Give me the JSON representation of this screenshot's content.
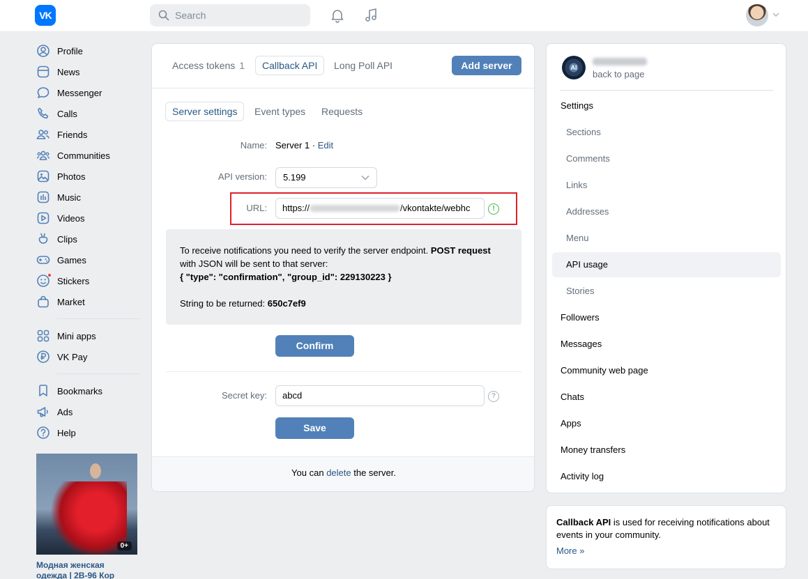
{
  "header": {
    "logo_text": "VK",
    "search_placeholder": "Search"
  },
  "nav": {
    "items": [
      {
        "label": "Profile",
        "icon": "user-circle-icon"
      },
      {
        "label": "News",
        "icon": "news-icon"
      },
      {
        "label": "Messenger",
        "icon": "chat-bubble-icon"
      },
      {
        "label": "Calls",
        "icon": "phone-icon"
      },
      {
        "label": "Friends",
        "icon": "friends-icon"
      },
      {
        "label": "Communities",
        "icon": "communities-icon"
      },
      {
        "label": "Photos",
        "icon": "photo-icon"
      },
      {
        "label": "Music",
        "icon": "music-bars-icon"
      },
      {
        "label": "Videos",
        "icon": "video-play-icon"
      },
      {
        "label": "Clips",
        "icon": "clips-icon"
      },
      {
        "label": "Games",
        "icon": "gamepad-icon"
      },
      {
        "label": "Stickers",
        "icon": "smiley-icon"
      },
      {
        "label": "Market",
        "icon": "shopping-bag-icon"
      }
    ],
    "items2": [
      {
        "label": "Mini apps",
        "icon": "grid-icon"
      },
      {
        "label": "VK Pay",
        "icon": "ruble-icon"
      }
    ],
    "items3": [
      {
        "label": "Bookmarks",
        "icon": "bookmark-icon"
      },
      {
        "label": "Ads",
        "icon": "megaphone-icon"
      },
      {
        "label": "Help",
        "icon": "question-icon"
      }
    ]
  },
  "ad": {
    "badge": "0+",
    "title": "Модная женская одежда | 2В-96 Кор"
  },
  "main": {
    "tabs": {
      "access_tokens": "Access tokens",
      "access_tokens_count": "1",
      "callback_api": "Callback API",
      "long_poll_api": "Long Poll API"
    },
    "add_server": "Add server",
    "subtabs": {
      "server_settings": "Server settings",
      "event_types": "Event types",
      "requests": "Requests"
    },
    "name_label": "Name:",
    "name_value": "Server 1 ·",
    "name_edit": "Edit",
    "api_version_label": "API version:",
    "api_version_value": "5.199",
    "url_label": "URL:",
    "url_prefix": "https://",
    "url_suffix": "/vkontakte/webhc",
    "notice": {
      "line1": "To receive notifications you need to verify the server endpoint.",
      "bold1": "POST request",
      "line1b": "with JSON will be sent to that server:",
      "json": "{ \"type\": \"confirmation\", \"group_id\": 229130223 }",
      "return_label": "String to be returned:",
      "return_value": "650c7ef9"
    },
    "confirm": "Confirm",
    "secret_label": "Secret key:",
    "secret_value": "abcd",
    "save": "Save",
    "footer_pre": "You can",
    "footer_link": "delete",
    "footer_post": "the server."
  },
  "right": {
    "community_avatar_text": "AI",
    "back_to_page": "back to page",
    "menu": [
      {
        "label": "Settings",
        "sub": false
      },
      {
        "label": "Sections",
        "sub": true
      },
      {
        "label": "Comments",
        "sub": true
      },
      {
        "label": "Links",
        "sub": true
      },
      {
        "label": "Addresses",
        "sub": true
      },
      {
        "label": "Menu",
        "sub": true
      },
      {
        "label": "API usage",
        "sub": true,
        "selected": true
      },
      {
        "label": "Stories",
        "sub": true
      },
      {
        "label": "Followers",
        "sub": false
      },
      {
        "label": "Messages",
        "sub": false
      },
      {
        "label": "Community web page",
        "sub": false
      },
      {
        "label": "Chats",
        "sub": false
      },
      {
        "label": "Apps",
        "sub": false
      },
      {
        "label": "Money transfers",
        "sub": false
      },
      {
        "label": "Activity log",
        "sub": false
      }
    ]
  },
  "info": {
    "bold": "Callback API",
    "text": "is used for receiving notifications about events in your community.",
    "more": "More »"
  },
  "colors": {
    "accent": "#5181b8",
    "link": "#2a5885",
    "highlight_border": "#e0202a",
    "background": "#edeef0"
  }
}
